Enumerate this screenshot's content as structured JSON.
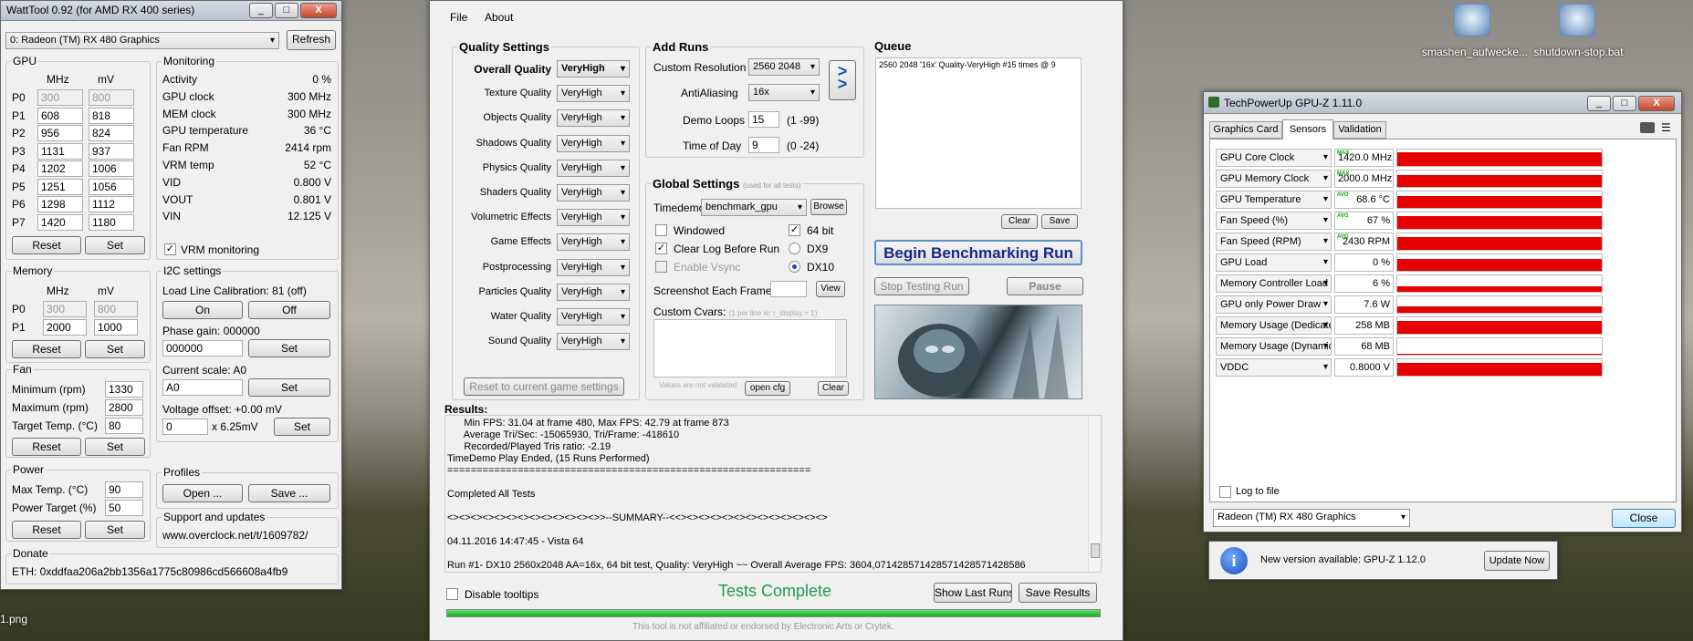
{
  "desktop": {
    "icons": [
      {
        "label": "smashen_aufwecke..."
      },
      {
        "label": "shutdown-stop.bat"
      }
    ],
    "file_label": "1.png"
  },
  "watttool": {
    "title": "WattTool 0.92 (for AMD RX 400 series)",
    "gpu_select": "0: Radeon (TM) RX 480 Graphics",
    "refresh": "Refresh",
    "gpu_group": "GPU",
    "mhz": "MHz",
    "mv": "mV",
    "pstates": [
      {
        "p": "P0",
        "mhz": "300",
        "mv": "800",
        "disabled": true
      },
      {
        "p": "P1",
        "mhz": "608",
        "mv": "818"
      },
      {
        "p": "P2",
        "mhz": "956",
        "mv": "824"
      },
      {
        "p": "P3",
        "mhz": "1131",
        "mv": "937"
      },
      {
        "p": "P4",
        "mhz": "1202",
        "mv": "1006"
      },
      {
        "p": "P5",
        "mhz": "1251",
        "mv": "1056"
      },
      {
        "p": "P6",
        "mhz": "1298",
        "mv": "1112"
      },
      {
        "p": "P7",
        "mhz": "1420",
        "mv": "1180"
      }
    ],
    "reset": "Reset",
    "set": "Set",
    "monitoring_group": "Monitoring",
    "monitoring": [
      {
        "label": "Activity",
        "value": "0 %"
      },
      {
        "label": "GPU clock",
        "value": "300 MHz"
      },
      {
        "label": "MEM clock",
        "value": "300 MHz"
      },
      {
        "label": "GPU temperature",
        "value": "36 °C"
      },
      {
        "label": "Fan RPM",
        "value": "2414 rpm"
      },
      {
        "label": "VRM temp",
        "value": "52 °C"
      },
      {
        "label": "VID",
        "value": "0.800 V"
      },
      {
        "label": "VOUT",
        "value": "0.801 V"
      },
      {
        "label": "VIN",
        "value": "12.125 V"
      }
    ],
    "vrm_monitoring": "VRM monitoring",
    "memory_group": "Memory",
    "mem_states": [
      {
        "p": "P0",
        "mhz": "300",
        "mv": "800",
        "disabled": true
      },
      {
        "p": "P1",
        "mhz": "2000",
        "mv": "1000"
      }
    ],
    "i2c_group": "I2C settings",
    "llc_label": "Load Line Calibration: 81 (off)",
    "on": "On",
    "off": "Off",
    "phase_label": "Phase gain: 000000",
    "phase_value": "000000",
    "scale_label": "Current scale: A0",
    "scale_value": "A0",
    "voltage_label": "Voltage offset: +0.00 mV",
    "voltage_value": "0",
    "voltage_unit": "x 6.25mV",
    "fan_group": "Fan",
    "fan_min_label": "Minimum (rpm)",
    "fan_min": "1330",
    "fan_max_label": "Maximum (rpm)",
    "fan_max": "2800",
    "target_temp_label": "Target Temp. (°C)",
    "target_temp": "80",
    "power_group": "Power",
    "max_temp_label": "Max Temp. (°C)",
    "max_temp": "90",
    "power_target_label": "Power Target (%)",
    "power_target": "50",
    "profiles_group": "Profiles",
    "open": "Open ...",
    "save": "Save ...",
    "support_group": "Support and updates",
    "support_url": "www.overclock.net/t/1609782/",
    "donate_group": "Donate",
    "eth": "ETH:   0xddfaa206a2bb1356a1775c80986cd566608a4fb9"
  },
  "bench": {
    "menu": [
      "File",
      "About"
    ],
    "quality_title": "Quality Settings",
    "quality": [
      {
        "label": "Overall Quality",
        "value": "VeryHigh",
        "bold": true
      },
      {
        "label": "Texture Quality",
        "value": "VeryHigh"
      },
      {
        "label": "Objects Quality",
        "value": "VeryHigh"
      },
      {
        "label": "Shadows Quality",
        "value": "VeryHigh"
      },
      {
        "label": "Physics Quality",
        "value": "VeryHigh"
      },
      {
        "label": "Shaders Quality",
        "value": "VeryHigh"
      },
      {
        "label": "Volumetric Effects",
        "value": "VeryHigh"
      },
      {
        "label": "Game Effects",
        "value": "VeryHigh"
      },
      {
        "label": "Postprocessing",
        "value": "VeryHigh"
      },
      {
        "label": "Particles Quality",
        "value": "VeryHigh"
      },
      {
        "label": "Water Quality",
        "value": "VeryHigh"
      },
      {
        "label": "Sound Quality",
        "value": "VeryHigh"
      }
    ],
    "reset_game": "Reset to current game settings",
    "add_runs_title": "Add Runs",
    "resolution_label": "Custom Resolution",
    "resolution": "2560 2048",
    "aa_label": "AntiAliasing",
    "aa": "16x",
    "demo_loops_label": "Demo Loops",
    "demo_loops": "15",
    "demo_loops_range": "(1 -99)",
    "tod_label": "Time of Day",
    "tod": "9",
    "tod_range": "(0 -24)",
    "add_arrow": ">",
    "queue_title": "Queue",
    "queue_item": "2560 2048 '16x' Quality-VeryHigh #15 times @ 9",
    "clear": "Clear",
    "save": "Save",
    "global_title": "Global Settings",
    "global_note": "(used for all tests)",
    "timedemo_label": "Timedemo",
    "timedemo": "benchmark_gpu",
    "browse": "Browse",
    "windowed": "Windowed",
    "bit64": "64 bit",
    "clear_log": "Clear Log Before Run",
    "dx9": "DX9",
    "vsync": "Enable Vsync",
    "dx10": "DX10",
    "screenshot_label": "Screenshot Each Frame",
    "view": "View",
    "cvars_label": "Custom Cvars:",
    "cvars_hint": "(1 per line ie: r_display = 1)",
    "cvars_note": "Values are not validated",
    "open_cfg": "open cfg",
    "cvars_clear": "Clear",
    "begin": "Begin Benchmarking Run",
    "stop": "Stop Testing Run",
    "pause": "Pause",
    "results_title": "Results:",
    "results": [
      "      Min FPS: 31.04 at frame 480, Max FPS: 42.79 at frame 873",
      "      Average Tri/Sec: -15065930, Tri/Frame: -418610",
      "      Recorded/Played Tris ratio: -2.19",
      "TimeDemo Play Ended, (15 Runs Performed)",
      "==============================================================",
      "",
      "Completed All Tests",
      "",
      "<><><><><><><><><><><><><>>--SUMMARY--<<><><><><><><><><><><><><>",
      "",
      "04.11.2016 14:47:45 - Vista 64",
      "",
      "Run #1- DX10 2560x2048 AA=16x, 64 bit test, Quality: VeryHigh ~~ Overall Average FPS: 3604,071428571428571428571428586"
    ],
    "disable_tooltips": "Disable tooltips",
    "status": "Tests Complete",
    "show_last": "Show Last Runs",
    "save_results": "Save Results",
    "progress": 100,
    "disclaimer": "This tool is not affiliated or endorsed by Electronic Arts or Crytek."
  },
  "gpuz": {
    "title": "TechPowerUp GPU-Z 1.11.0",
    "tabs": [
      "Graphics Card",
      "Sensors",
      "Validation"
    ],
    "sensors": [
      {
        "name": "GPU Core Clock",
        "value": "1420.0 MHz",
        "avg": "MAX"
      },
      {
        "name": "GPU Memory Clock",
        "value": "2000.0 MHz",
        "avg": "MAX"
      },
      {
        "name": "GPU Temperature",
        "value": "68.6 °C",
        "avg": "AVG"
      },
      {
        "name": "Fan Speed (%)",
        "value": "67 %",
        "avg": "AVG"
      },
      {
        "name": "Fan Speed (RPM)",
        "value": "2430 RPM",
        "avg": "AVG"
      },
      {
        "name": "GPU Load",
        "value": "0 %",
        "avg": ""
      },
      {
        "name": "Memory Controller Load",
        "value": "6 %",
        "avg": ""
      },
      {
        "name": "GPU only Power Draw",
        "value": "7.6 W",
        "avg": ""
      },
      {
        "name": "Memory Usage (Dedicated)",
        "value": "258 MB",
        "avg": ""
      },
      {
        "name": "Memory Usage (Dynamic)",
        "value": "68 MB",
        "avg": ""
      },
      {
        "name": "VDDC",
        "value": "0.8000 V",
        "avg": ""
      }
    ],
    "log_to_file": "Log to file",
    "card": "Radeon (TM) RX 480 Graphics",
    "close": "Close",
    "update_text": "New version available: GPU-Z 1.12.0",
    "update_now": "Update Now"
  }
}
